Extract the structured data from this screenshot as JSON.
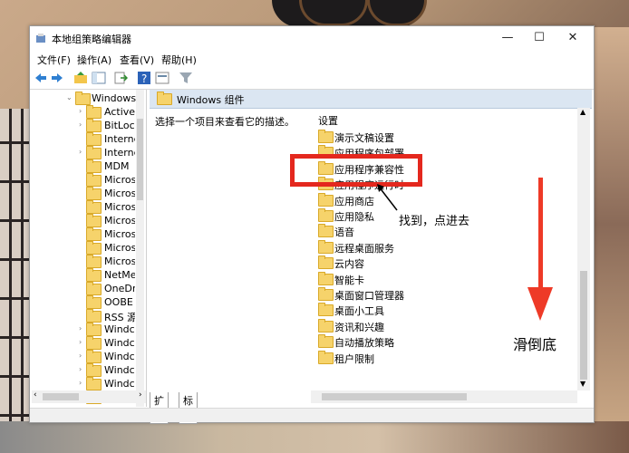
{
  "window": {
    "title": "本地组策略编辑器",
    "minimize": "—",
    "maximize": "☐",
    "close": "✕"
  },
  "menu": [
    "文件(F)",
    "操作(A)",
    "查看(V)",
    "帮助(H)"
  ],
  "toolbar_icons": [
    "back-arrow-icon",
    "forward-arrow-icon",
    "up-folder-icon",
    "show-hide-tree-icon",
    "export-list-icon",
    "help-icon",
    "properties-icon",
    "filter-icon"
  ],
  "tree": {
    "root_label": "Windows",
    "items": [
      "Active",
      "BitLoc",
      "Interne",
      "Interne",
      "MDM",
      "Micros",
      "Micros",
      "Micros",
      "Micros",
      "Micros",
      "Micros",
      "Micros",
      "NetMe",
      "OneDr",
      "OOBE",
      "RSS 源",
      "Windc",
      "Windc",
      "Windc",
      "Windc",
      "Windc",
      "Windc"
    ]
  },
  "right_pane": {
    "header": "Windows 组件",
    "description": "选择一个项目来查看它的描述。",
    "column_header": "设置",
    "items": [
      "演示文稿设置",
      "应用程序包部署",
      "应用程序兼容性",
      "应用程序运行时",
      "应用商店",
      "应用隐私",
      "语音",
      "远程桌面服务",
      "云内容",
      "智能卡",
      "桌面窗口管理器",
      "桌面小工具",
      "资讯和兴趣",
      "自动播放策略",
      "租户限制"
    ]
  },
  "tabs": [
    "扩展",
    "标准"
  ],
  "annotations": {
    "found_note": "找到，点进去",
    "scroll_note": "滑倒底",
    "highlight_color": "#e4281e"
  }
}
